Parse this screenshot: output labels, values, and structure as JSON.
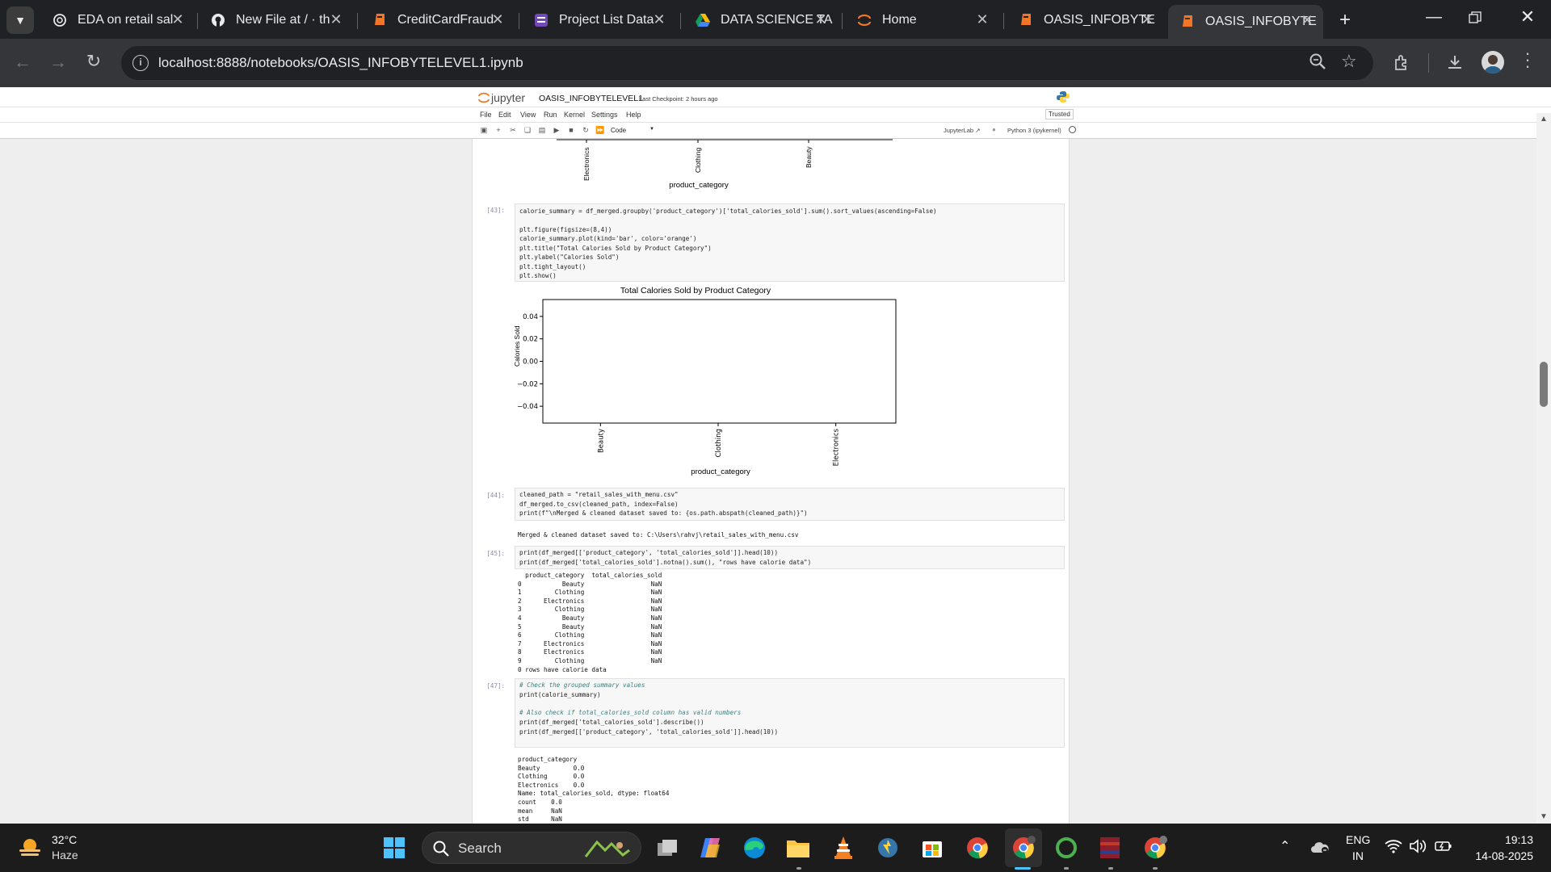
{
  "browser": {
    "tabs": [
      {
        "title": "EDA on retail sal",
        "icon": "openai-icon"
      },
      {
        "title": "New File at / · th",
        "icon": "github-icon"
      },
      {
        "title": "CreditCardFraud",
        "icon": "jupyter-notebook-icon"
      },
      {
        "title": "Project List Data",
        "icon": "forms-icon"
      },
      {
        "title": "DATA SCIENCE TA",
        "icon": "google-drive-icon"
      },
      {
        "title": "Home",
        "icon": "jupyter-icon"
      },
      {
        "title": "OASIS_INFOBYTE",
        "icon": "jupyter-notebook-icon"
      },
      {
        "title": "OASIS_INFOBYTE",
        "icon": "jupyter-notebook-icon"
      }
    ],
    "url": "localhost:8888/notebooks/OASIS_INFOBYTELEVEL1.ipynb"
  },
  "jupyter": {
    "logo_text": "jupyter",
    "notebook_name": "OASIS_INFOBYTELEVEL1",
    "checkpoint": "Last Checkpoint: 2 hours ago",
    "menu": [
      "File",
      "Edit",
      "View",
      "Run",
      "Kernel",
      "Settings",
      "Help"
    ],
    "trusted": "Trusted",
    "cell_type": "Code",
    "jupyterlab_link": "JupyterLab",
    "kernel": "Python 3 (ipykernel)"
  },
  "cells": {
    "top_chart": {
      "tick_labels": [
        "Electronics",
        "Clothing",
        "Beauty"
      ],
      "xlabel": "product_category"
    },
    "c43": {
      "prompt": "[43]:",
      "lines": [
        "calorie_summary = df_merged.groupby('product_category')['total_calories_sold'].sum().sort_values(ascending=False)",
        "",
        "plt.figure(figsize=(8,4))",
        "calorie_summary.plot(kind='bar', color='orange')",
        "plt.title(\"Total Calories Sold by Product Category\")",
        "plt.ylabel(\"Calories Sold\")",
        "plt.tight_layout()",
        "plt.show()"
      ]
    },
    "c44": {
      "prompt": "[44]:",
      "lines": [
        "cleaned_path = \"retail_sales_with_menu.csv\"",
        "df_merged.to_csv(cleaned_path, index=False)",
        "print(f\"\\nMerged & cleaned dataset saved to: {os.path.abspath(cleaned_path)}\")"
      ],
      "output": "Merged & cleaned dataset saved to: C:\\Users\\rahvj\\retail_sales_with_menu.csv"
    },
    "c45": {
      "prompt": "[45]:",
      "lines": [
        "print(df_merged[['product_category', 'total_calories_sold']].head(10))",
        "print(df_merged['total_calories_sold'].notna().sum(), \"rows have calorie data\")"
      ],
      "output": "  product_category  total_calories_sold\n0           Beauty                  NaN\n1         Clothing                  NaN\n2      Electronics                  NaN\n3         Clothing                  NaN\n4           Beauty                  NaN\n5           Beauty                  NaN\n6         Clothing                  NaN\n7      Electronics                  NaN\n8      Electronics                  NaN\n9         Clothing                  NaN\n0 rows have calorie data"
    },
    "c47": {
      "prompt": "[47]:",
      "lines": [
        "# Check the grouped summary values",
        "print(calorie_summary)",
        "",
        "# Also check if total_calories_sold column has valid numbers",
        "print(df_merged['total_calories_sold'].describe())",
        "print(df_merged[['product_category', 'total_calories_sold']].head(10))"
      ],
      "output": "product_category\nBeauty         0.0\nClothing       0.0\nElectronics    0.0\nName: total_calories_sold, dtype: float64\ncount    0.0\nmean     NaN\nstd      NaN"
    }
  },
  "chart_data": {
    "type": "bar",
    "title": "Total Calories Sold by Product Category",
    "categories": [
      "Beauty",
      "Clothing",
      "Electronics"
    ],
    "values": [
      0,
      0,
      0
    ],
    "xlabel": "product_category",
    "ylabel": "Calories Sold",
    "yticks": [
      "0.04",
      "0.02",
      "0.00",
      "−0.02",
      "−0.04"
    ],
    "ylim": [
      -0.055,
      0.055
    ],
    "bar_color": "#ffa500"
  },
  "taskbar": {
    "weather_temp": "32°C",
    "weather_desc": "Haze",
    "search_label": "Search",
    "lang_top": "ENG",
    "lang_bottom": "IN",
    "time": "19:13",
    "date": "14-08-2025"
  },
  "colors": {
    "chrome_bg": "#202124",
    "toolbar_bg": "#35363a",
    "jupyter_orange": "#f37626"
  }
}
